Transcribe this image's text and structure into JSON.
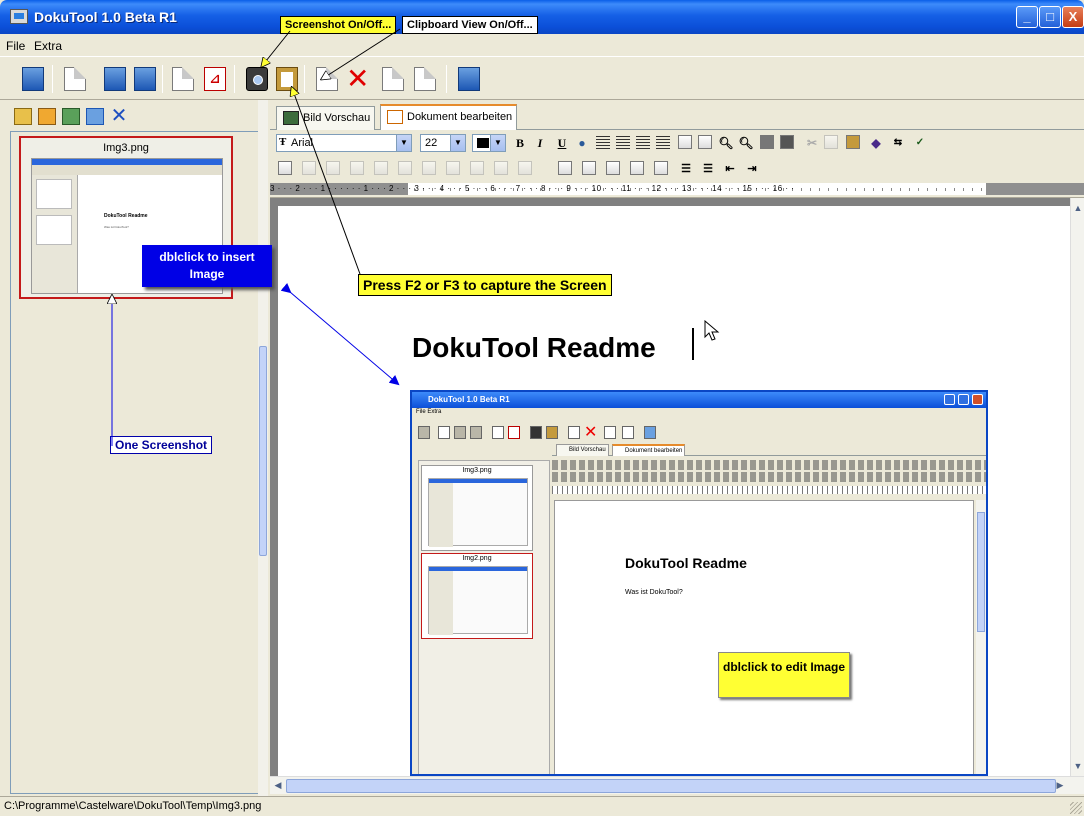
{
  "window": {
    "title": "DokuTool 1.0 Beta R1",
    "minimize": "_",
    "maximize": "□",
    "close": "X"
  },
  "menu": {
    "file": "File",
    "extra": "Extra"
  },
  "left": {
    "thumb_caption": "Img3.png",
    "mini_heading": "DokuTool Readme",
    "mini_para": "Was ist DokuTool?"
  },
  "tabs": {
    "preview": "Bild Vorschau",
    "edit": "Dokument bearbeiten"
  },
  "format": {
    "font": "Arial",
    "size": "22",
    "bold": "B",
    "italic": "I",
    "underline": "U"
  },
  "ruler_text": "3 · · · 2 · · · 1 · · ·  · · · 1 · · · 2 · · · 3 · · · 4 · · · 5 · · · 6 · · · 7 · · · 8 · · · 9 · · · 10 · · · 11 · · · 12 · · · 13 · · · 14 · · · 15 · · · 16 · ·",
  "document": {
    "heading": "DokuTool Readme"
  },
  "embedded": {
    "title": "DokuTool 1.0 Beta R1",
    "menu": "File  Extra",
    "thumb1": "Img3.png",
    "thumb2": "Img2.png",
    "tab1": "Bild Vorschau",
    "tab2": "Dokument bearbeiten",
    "heading": "DokuTool Readme",
    "para": "Was ist DokuTool?",
    "callout": "dblclick to edit Image"
  },
  "callouts": {
    "screenshot": "Screenshot On/Off...",
    "clipboard": "Clipboard View On/Off...",
    "insert_line1": "dblclick to insert",
    "insert_line2": "Image",
    "press": "Press F2 or F3 to capture the Screen",
    "one_screenshot": "One Screenshot"
  },
  "status": {
    "path": "C:\\Programme\\Castelware\\DokuTool\\Temp\\Img3.png"
  }
}
